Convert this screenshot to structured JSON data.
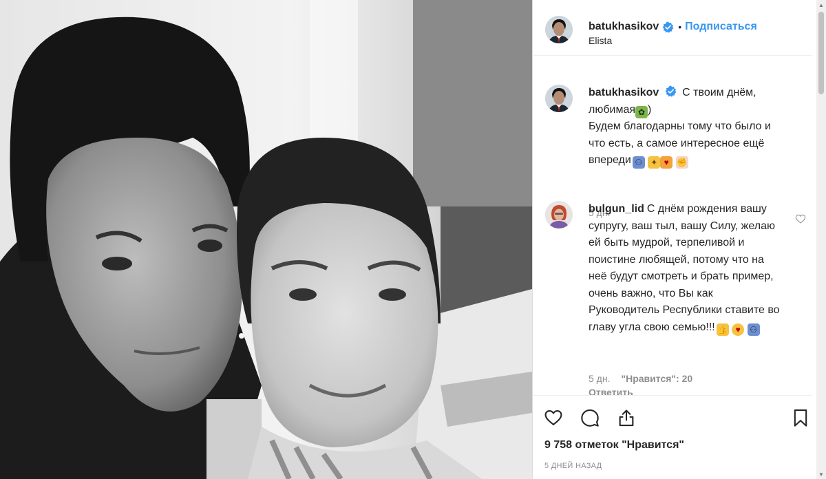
{
  "post": {
    "author": "batukhasikov",
    "follow_label": "Подписаться",
    "location": "Elista",
    "caption_lines": [
      "С твоим днём, любимая",
      ")",
      "Будем благодарны тому что было и что есть, а самое интересное ещё впереди"
    ],
    "caption_time": "5 дн."
  },
  "comments": [
    {
      "author": "bulgun_lid",
      "text": "С днём рождения вашу супругу, ваш тыл, вашу Силу, желаю ей быть мудрой, терпеливой и поистине любящей, потому что на неё будут смотреть и брать пример, очень важно, что Вы как Руководитель Республики ставите во главу угла свою семью!!!",
      "time": "5 дн.",
      "likes": "\"Нравится\": 20",
      "reply": "Ответить"
    }
  ],
  "footer": {
    "likes": "9 758 отметок \"Нравится\"",
    "date": "5 ДНЕЙ НАЗАД"
  },
  "icons": {
    "like": "heart-outline-icon",
    "comment": "speech-bubble-icon",
    "share": "share-upload-icon",
    "save": "bookmark-icon",
    "verified": "verified-badge-icon"
  },
  "colors": {
    "link": "#3897f0",
    "text": "#262626",
    "muted": "#8e8e8e",
    "verified": "#3897f0"
  }
}
